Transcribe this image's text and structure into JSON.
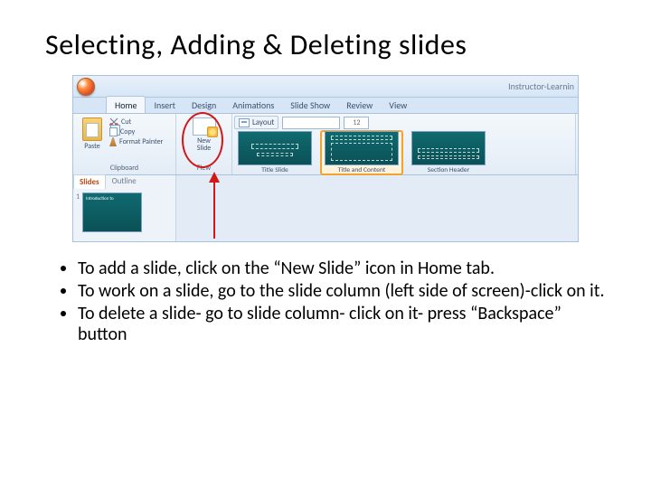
{
  "slide": {
    "title": "Selecting, Adding & Deleting slides"
  },
  "powerpoint": {
    "titlebar_right": "Instructor-Learnin",
    "tabs": {
      "home": "Home",
      "insert": "Insert",
      "design": "Design",
      "animations": "Animations",
      "slide_show": "Slide Show",
      "review": "Review",
      "view": "View"
    },
    "clipboard": {
      "paste": "Paste",
      "cut": "Cut",
      "copy": "Copy",
      "format_painter": "Format Painter",
      "group_label": "Clipboard"
    },
    "slides_group": {
      "new_slide": "New\nSlide",
      "group_label": "Flew"
    },
    "layout_btn": "Layout",
    "font_size_placeholder": "12",
    "gallery": {
      "title_slide": "Title Slide",
      "title_content": "Title and Content",
      "section_header": "Section Header"
    },
    "panel": {
      "slides_tab": "Slides",
      "outline_tab": "Outline",
      "thumb1_num": "1",
      "thumb1_title": "Introduction to"
    }
  },
  "bullets": {
    "b1": "To add a slide, click on the “New Slide” icon in Home tab.",
    "b2": "To work on a slide, go to the slide column (left side of screen)-click on it.",
    "b3": "To delete a slide- go to slide column- click on it- press “Backspace” button"
  }
}
